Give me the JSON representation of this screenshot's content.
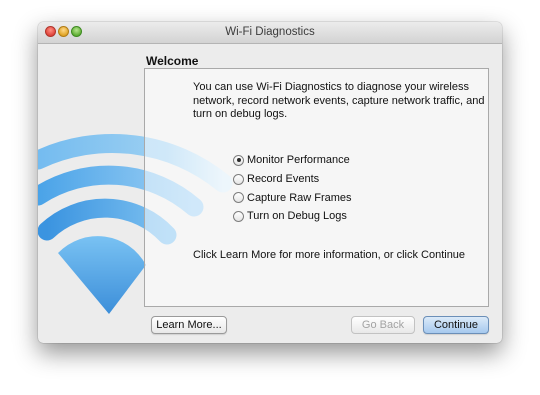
{
  "window": {
    "title": "Wi-Fi Diagnostics"
  },
  "content": {
    "heading": "Welcome",
    "description": "You can use Wi-Fi Diagnostics to diagnose your wireless network, record network events, capture network traffic, and turn on debug logs.",
    "options": [
      {
        "label": "Monitor Performance",
        "selected": true
      },
      {
        "label": "Record Events",
        "selected": false
      },
      {
        "label": "Capture Raw Frames",
        "selected": false
      },
      {
        "label": "Turn on Debug Logs",
        "selected": false
      }
    ],
    "footer_text": "Click Learn More for more information, or click Continue"
  },
  "buttons": {
    "learn_more": "Learn More...",
    "go_back": "Go Back",
    "continue": "Continue"
  },
  "colors": {
    "wifi_icon": "#5aa9e6",
    "default_button": "#a6c9ee"
  }
}
